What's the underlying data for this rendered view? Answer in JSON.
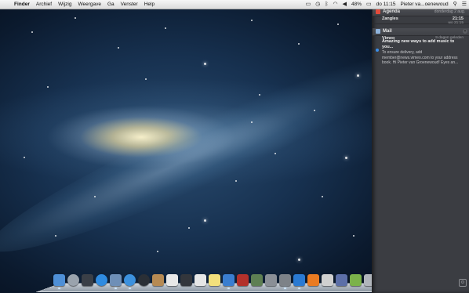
{
  "menubar": {
    "apple_glyph": "",
    "items": [
      "Finder",
      "Archief",
      "Wijzig",
      "Weergave",
      "Ga",
      "Venster",
      "Help"
    ],
    "battery": "48%",
    "clock": "do 11:15",
    "user": "Pieter va...oenewoud"
  },
  "notification_center": {
    "agenda": {
      "title": "Agenda",
      "date": "donderdag 2 aug.",
      "event_name": "Zangles",
      "event_time": "21:15",
      "event_day": "wo 21:15"
    },
    "mail": {
      "title": "Mail",
      "sender": "Vimeo",
      "age": "9 dagen geleden",
      "subject": "Amazing new ways to add music to you...",
      "preview": "To ensure delivery, add member@news.vimeo.com to your address book. Hi Pieter van Groenewoud! Eyes an..."
    }
  },
  "dock": {
    "apps": [
      {
        "name": "finder",
        "color": "#4e8fd6"
      },
      {
        "name": "launchpad",
        "color": "#9aa3ad"
      },
      {
        "name": "mission-control",
        "color": "#3a3f47"
      },
      {
        "name": "app-store",
        "color": "#2f8be0"
      },
      {
        "name": "mail",
        "color": "#6e8fb7"
      },
      {
        "name": "safari",
        "color": "#3c91de"
      },
      {
        "name": "facetime",
        "color": "#2a2f36"
      },
      {
        "name": "contacts",
        "color": "#b68a53"
      },
      {
        "name": "calendar",
        "color": "#e8e8e8"
      },
      {
        "name": "photo-booth",
        "color": "#33363c"
      },
      {
        "name": "preview",
        "color": "#e6e6e6"
      },
      {
        "name": "notes",
        "color": "#f3e07c"
      },
      {
        "name": "itunes",
        "color": "#3a7ed0"
      },
      {
        "name": "photo-booth-red",
        "color": "#b3312b"
      },
      {
        "name": "iphoto",
        "color": "#5e7f53"
      },
      {
        "name": "image-capture",
        "color": "#8a8f96"
      },
      {
        "name": "system-preferences",
        "color": "#7d8288"
      },
      {
        "name": "word",
        "color": "#2a7ad3"
      },
      {
        "name": "vlc",
        "color": "#ea7b22"
      },
      {
        "name": "pages",
        "color": "#d0d0d0"
      },
      {
        "name": "keynote",
        "color": "#5c6fa8"
      },
      {
        "name": "numbers",
        "color": "#7bb24a"
      },
      {
        "name": "grab",
        "color": "#b0b5bb"
      },
      {
        "name": "quicktime",
        "color": "#2e6bbd"
      }
    ],
    "right_items": [
      {
        "name": "applications-folder",
        "color": "#7fa7d6"
      },
      {
        "name": "downloads-stack",
        "color": "#dcdcdc"
      },
      {
        "name": "trash",
        "color": "#c7cdd4"
      }
    ]
  }
}
